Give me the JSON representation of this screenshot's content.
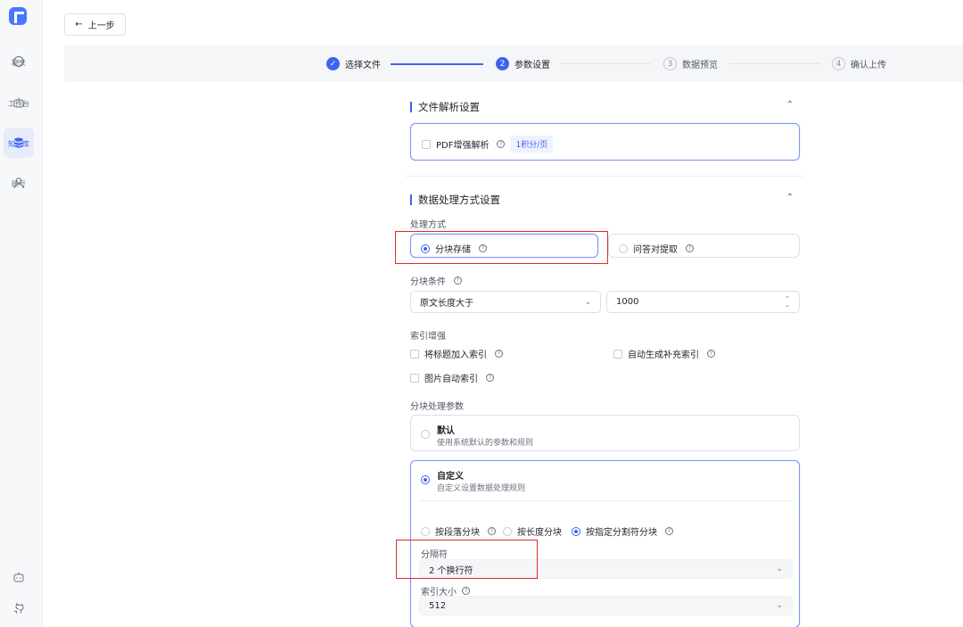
{
  "nav": {
    "items": [
      {
        "label": "聊天",
        "icon": "chat-icon"
      },
      {
        "label": "工作台",
        "icon": "robot-icon"
      },
      {
        "label": "知识库",
        "icon": "database-icon",
        "active": true
      },
      {
        "label": "账号",
        "icon": "user-icon"
      }
    ],
    "bottom_icons": [
      "robot-icon",
      "github-icon"
    ]
  },
  "back_button": {
    "label": "上一步"
  },
  "stepper": {
    "steps": [
      {
        "num": "✓",
        "label": "选择文件",
        "state": "done"
      },
      {
        "num": "2",
        "label": "参数设置",
        "state": "current"
      },
      {
        "num": "3",
        "label": "数据预览",
        "state": "todo"
      },
      {
        "num": "4",
        "label": "确认上传",
        "state": "todo"
      }
    ]
  },
  "file_parse": {
    "title": "文件解析设置",
    "pdf_enhance_label": "PDF增强解析",
    "pdf_tag": "1积分/页"
  },
  "processing": {
    "title": "数据处理方式设置",
    "method_label": "处理方式",
    "method_chunk": "分块存储",
    "method_qa": "问答对提取",
    "condition_label": "分块条件",
    "condition_select": "原文长度大于",
    "condition_value": "1000",
    "index_label": "索引增强",
    "index_title": "将标题加入索引",
    "index_auto": "自动生成补充索引",
    "index_image": "图片自动索引",
    "params_label": "分块处理参数",
    "default_title": "默认",
    "default_desc": "使用系统默认的参数和规则",
    "custom_title": "自定义",
    "custom_desc": "自定义设置数据处理规则",
    "split_by_paragraph": "按段落分块",
    "split_by_length": "按长度分块",
    "split_by_separator": "按指定分割符分块",
    "separator_label": "分隔符",
    "separator_value": "2 个换行符",
    "index_size_label": "索引大小",
    "index_size_value": "512"
  },
  "colors": {
    "accent": "#3f63f0",
    "highlight": "#e02b2b"
  }
}
